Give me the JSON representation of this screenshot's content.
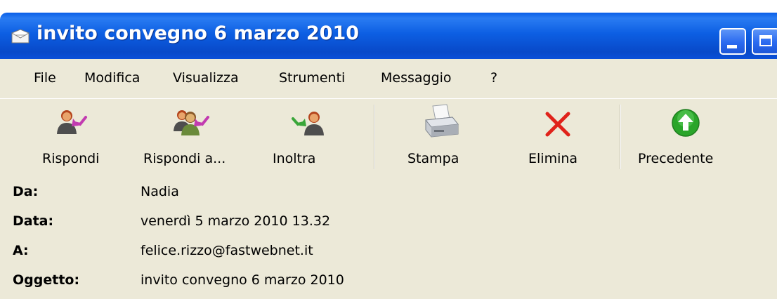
{
  "window": {
    "title": "invito convegno 6 marzo 2010",
    "icon": "envelope-icon"
  },
  "menu": {
    "items": [
      {
        "label": "File"
      },
      {
        "label": "Modifica"
      },
      {
        "label": "Visualizza"
      },
      {
        "label": "Strumenti"
      },
      {
        "label": "Messaggio"
      },
      {
        "label": "?"
      }
    ]
  },
  "toolbar": {
    "buttons": [
      {
        "label": "Rispondi",
        "icon": "reply-icon"
      },
      {
        "label": "Rispondi a...",
        "icon": "reply-all-icon"
      },
      {
        "label": "Inoltra",
        "icon": "forward-icon"
      },
      {
        "label": "Stampa",
        "icon": "printer-icon"
      },
      {
        "label": "Elimina",
        "icon": "delete-icon"
      },
      {
        "label": "Precedente",
        "icon": "previous-icon"
      }
    ]
  },
  "header": {
    "from_label": "Da:",
    "from_value": "Nadia",
    "date_label": "Data:",
    "date_value": "venerdì 5 marzo 2010 13.32",
    "to_label": "A:",
    "to_value": "felice.rizzo@fastwebnet.it",
    "subject_label": "Oggetto:",
    "subject_value": "invito convegno 6 marzo 2010"
  },
  "colors": {
    "titlebar": "#0a4fd8",
    "chrome": "#ece9d8",
    "delete_red": "#e0221a",
    "previous_green": "#2aa52a",
    "reply_arrow": "#c23bb0"
  }
}
